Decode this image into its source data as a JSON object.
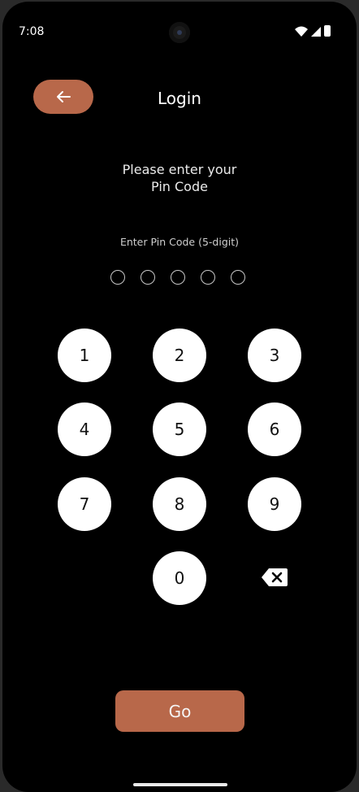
{
  "status_bar": {
    "time": "7:08",
    "icons": [
      "wifi-icon",
      "signal-icon",
      "battery-icon"
    ]
  },
  "header": {
    "title": "Login",
    "back_icon": "arrow-left-icon"
  },
  "prompt": {
    "line1": "Please enter your",
    "line2": "Pin Code"
  },
  "pin": {
    "label": "Enter Pin Code (5-digit)",
    "length": 5,
    "filled": 0
  },
  "keypad": {
    "keys": [
      "1",
      "2",
      "3",
      "4",
      "5",
      "6",
      "7",
      "8",
      "9",
      "0"
    ],
    "backspace_icon": "backspace-icon"
  },
  "actions": {
    "go_label": "Go"
  },
  "colors": {
    "accent": "#b8684a",
    "background": "#000000",
    "key_background": "#ffffff"
  }
}
